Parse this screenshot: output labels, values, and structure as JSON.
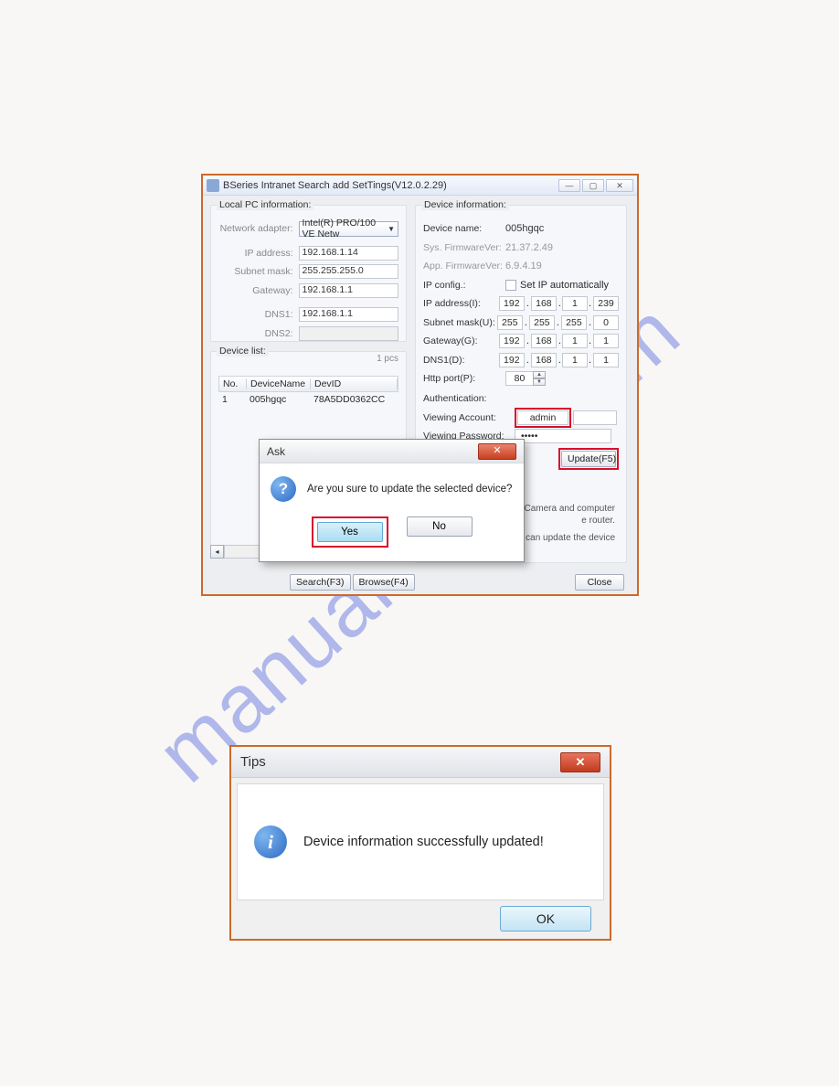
{
  "main": {
    "title": "BSeries Intranet Search add  SetTings(V12.0.2.29)",
    "localPC": {
      "heading": "Local PC information:",
      "networkAdapterLabel": "Network adapter:",
      "networkAdapterValue": "Intel(R) PRO/100 VE Netw",
      "ipLabel": "IP address:",
      "ip": "192.168.1.14",
      "subnetLabel": "Subnet mask:",
      "subnet": "255.255.255.0",
      "gatewayLabel": "Gateway:",
      "gateway": "192.168.1.1",
      "dns1Label": "DNS1:",
      "dns1": "192.168.1.1",
      "dns2Label": "DNS2:"
    },
    "deviceList": {
      "heading": "Device list:",
      "count": "1 pcs",
      "cols": {
        "no": "No.",
        "name": "DeviceName",
        "id": "DevID"
      },
      "rows": [
        {
          "no": "1",
          "name": "005hgqc",
          "id": "78A5DD0362CC"
        }
      ]
    },
    "deviceInfo": {
      "heading": "Device information:",
      "devnameLabel": "Device name:",
      "devname": "005hgqc",
      "sysfwLabel": "Sys. FirmwareVer:",
      "sysfw": "21.37.2.49",
      "appfwLabel": "App. FirmwareVer:",
      "appfw": "6.9.4.19",
      "ipconfigLabel": "IP config.:",
      "autoLabel": "Set IP automatically",
      "ipLabel": "IP address(I):",
      "ip": [
        "192",
        "168",
        "1",
        "239"
      ],
      "subnetLabel": "Subnet mask(U):",
      "subnet": [
        "255",
        "255",
        "255",
        "0"
      ],
      "gwLabel": "Gateway(G):",
      "gw": [
        "192",
        "168",
        "1",
        "1"
      ],
      "dnsLabel": "DNS1(D):",
      "dns": [
        "192",
        "168",
        "1",
        "1"
      ],
      "portLabel": "Http port(P):",
      "port": "80",
      "authLabel": "Authentication:",
      "accLabel": "Viewing Account:",
      "acc": "admin",
      "pwdLabel": "Viewing Password:",
      "pwd": "•••••",
      "updateBtn": "Update(F5)",
      "tip1": "Camera and computer",
      "tip1b": "e router.",
      "tip2": "ount can update the device"
    },
    "bottom": {
      "search": "Search(F3)",
      "browse": "Browse(F4)",
      "close": "Close"
    }
  },
  "ask": {
    "title": "Ask",
    "msg": "Are you sure to update the selected device?",
    "yes": "Yes",
    "no": "No"
  },
  "tips": {
    "title": "Tips",
    "msg": "Device information successfully updated!",
    "ok": "OK"
  }
}
